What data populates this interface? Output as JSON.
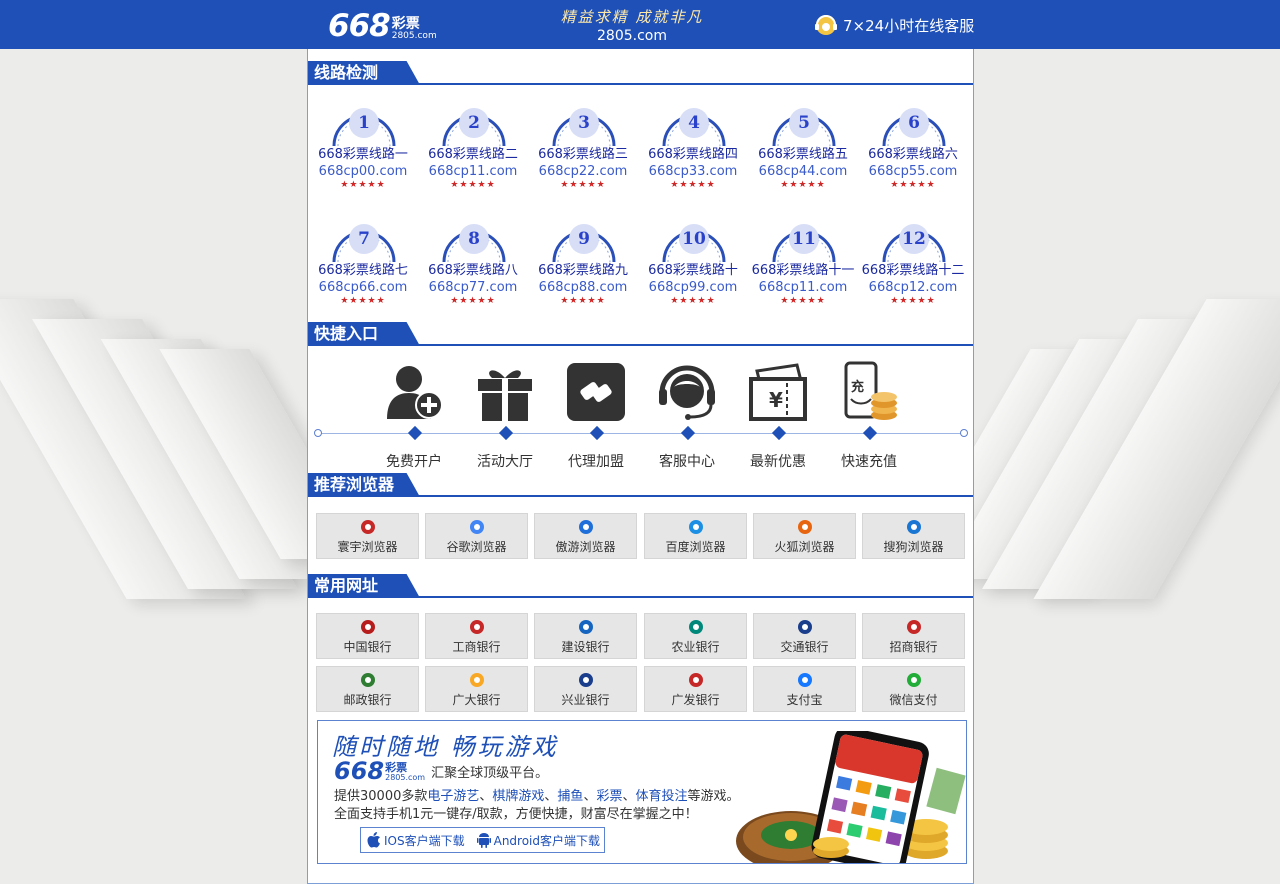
{
  "header": {
    "logo_main": "668",
    "logo_sub1": "彩票",
    "logo_sub2": "2805.com",
    "slogan_line1": "精益求精 成就非凡",
    "slogan_line2": "2805.com",
    "service_text": "7×24小时在线客服"
  },
  "sections": {
    "lines_title": "线路检测",
    "quick_title": "快捷入口",
    "browser_title": "推荐浏览器",
    "sites_title": "常用网址"
  },
  "lines": [
    {
      "num": "1",
      "name": "668彩票线路一",
      "url": "668cp00.com",
      "stars": "★★★★★"
    },
    {
      "num": "2",
      "name": "668彩票线路二",
      "url": "668cp11.com",
      "stars": "★★★★★"
    },
    {
      "num": "3",
      "name": "668彩票线路三",
      "url": "668cp22.com",
      "stars": "★★★★★"
    },
    {
      "num": "4",
      "name": "668彩票线路四",
      "url": "668cp33.com",
      "stars": "★★★★★"
    },
    {
      "num": "5",
      "name": "668彩票线路五",
      "url": "668cp44.com",
      "stars": "★★★★★"
    },
    {
      "num": "6",
      "name": "668彩票线路六",
      "url": "668cp55.com",
      "stars": "★★★★★"
    },
    {
      "num": "7",
      "name": "668彩票线路七",
      "url": "668cp66.com",
      "stars": "★★★★★"
    },
    {
      "num": "8",
      "name": "668彩票线路八",
      "url": "668cp77.com",
      "stars": "★★★★★"
    },
    {
      "num": "9",
      "name": "668彩票线路九",
      "url": "668cp88.com",
      "stars": "★★★★★"
    },
    {
      "num": "10",
      "name": "668彩票线路十",
      "url": "668cp99.com",
      "stars": "★★★★★"
    },
    {
      "num": "11",
      "name": "668彩票线路十一",
      "url": "668cp11.com",
      "stars": "★★★★★"
    },
    {
      "num": "12",
      "name": "668彩票线路十二",
      "url": "668cp12.com",
      "stars": "★★★★★"
    }
  ],
  "quick_links": [
    {
      "label": "免费开户",
      "icon": "user-add-icon"
    },
    {
      "label": "活动大厅",
      "icon": "gift-icon"
    },
    {
      "label": "代理加盟",
      "icon": "handshake-icon"
    },
    {
      "label": "客服中心",
      "icon": "headset-icon"
    },
    {
      "label": "最新优惠",
      "icon": "coupon-icon"
    },
    {
      "label": "快速充值",
      "icon": "recharge-icon"
    }
  ],
  "browsers": [
    {
      "label": "寰宇浏览器",
      "icon": "huanyu-browser-icon",
      "color": "#c62828"
    },
    {
      "label": "谷歌浏览器",
      "icon": "chrome-icon",
      "color": "#4285f4"
    },
    {
      "label": "傲游浏览器",
      "icon": "maxthon-icon",
      "color": "#1e6fd9"
    },
    {
      "label": "百度浏览器",
      "icon": "baidu-browser-icon",
      "color": "#1a8fe3"
    },
    {
      "label": "火狐浏览器",
      "icon": "firefox-icon",
      "color": "#e8650f"
    },
    {
      "label": "搜狗浏览器",
      "icon": "sogou-browser-icon",
      "color": "#1976d2"
    }
  ],
  "sites": [
    {
      "label": "中国银行",
      "icon": "boc-icon",
      "color": "#b71c1c"
    },
    {
      "label": "工商银行",
      "icon": "icbc-icon",
      "color": "#c62828"
    },
    {
      "label": "建设银行",
      "icon": "ccb-icon",
      "color": "#1565c0"
    },
    {
      "label": "农业银行",
      "icon": "abc-icon",
      "color": "#00897b"
    },
    {
      "label": "交通银行",
      "icon": "bocom-icon",
      "color": "#1a3e8c"
    },
    {
      "label": "招商银行",
      "icon": "cmb-icon",
      "color": "#c62828"
    },
    {
      "label": "邮政银行",
      "icon": "psbc-icon",
      "color": "#2e7d32"
    },
    {
      "label": "广大银行",
      "icon": "ceb-icon",
      "color": "#f9a825"
    },
    {
      "label": "兴业银行",
      "icon": "cib-icon",
      "color": "#1a3e8c"
    },
    {
      "label": "广发银行",
      "icon": "cgb-icon",
      "color": "#c62828"
    },
    {
      "label": "支付宝",
      "icon": "alipay-icon",
      "color": "#1677ff"
    },
    {
      "label": "微信支付",
      "icon": "wechat-pay-icon",
      "color": "#22ac38"
    }
  ],
  "promo": {
    "slogan": "随时随地 畅玩游戏",
    "brand_main": "668",
    "brand_sub1": "彩票",
    "brand_sub2": "2805.com",
    "brand_desc": "汇聚全球顶级平台。",
    "line1_prefix": "提供30000多款",
    "line1_hl1": "电子游艺",
    "sep1": "、",
    "line1_hl2": "棋牌游戏",
    "sep2": "、",
    "line1_hl3": "捕鱼",
    "sep3": "、",
    "line1_hl4": "彩票",
    "sep4": "、",
    "line1_hl5": "体育投注",
    "line1_suffix": "等游戏。",
    "line2": "全面支持手机1元一键存/取款，方便快捷，财富尽在掌握之中！",
    "ios_label": "IOS客户端下载",
    "android_label": "Android客户端下载"
  },
  "colors": {
    "brand_blue": "#1e50b8",
    "star_red": "#d02727"
  }
}
